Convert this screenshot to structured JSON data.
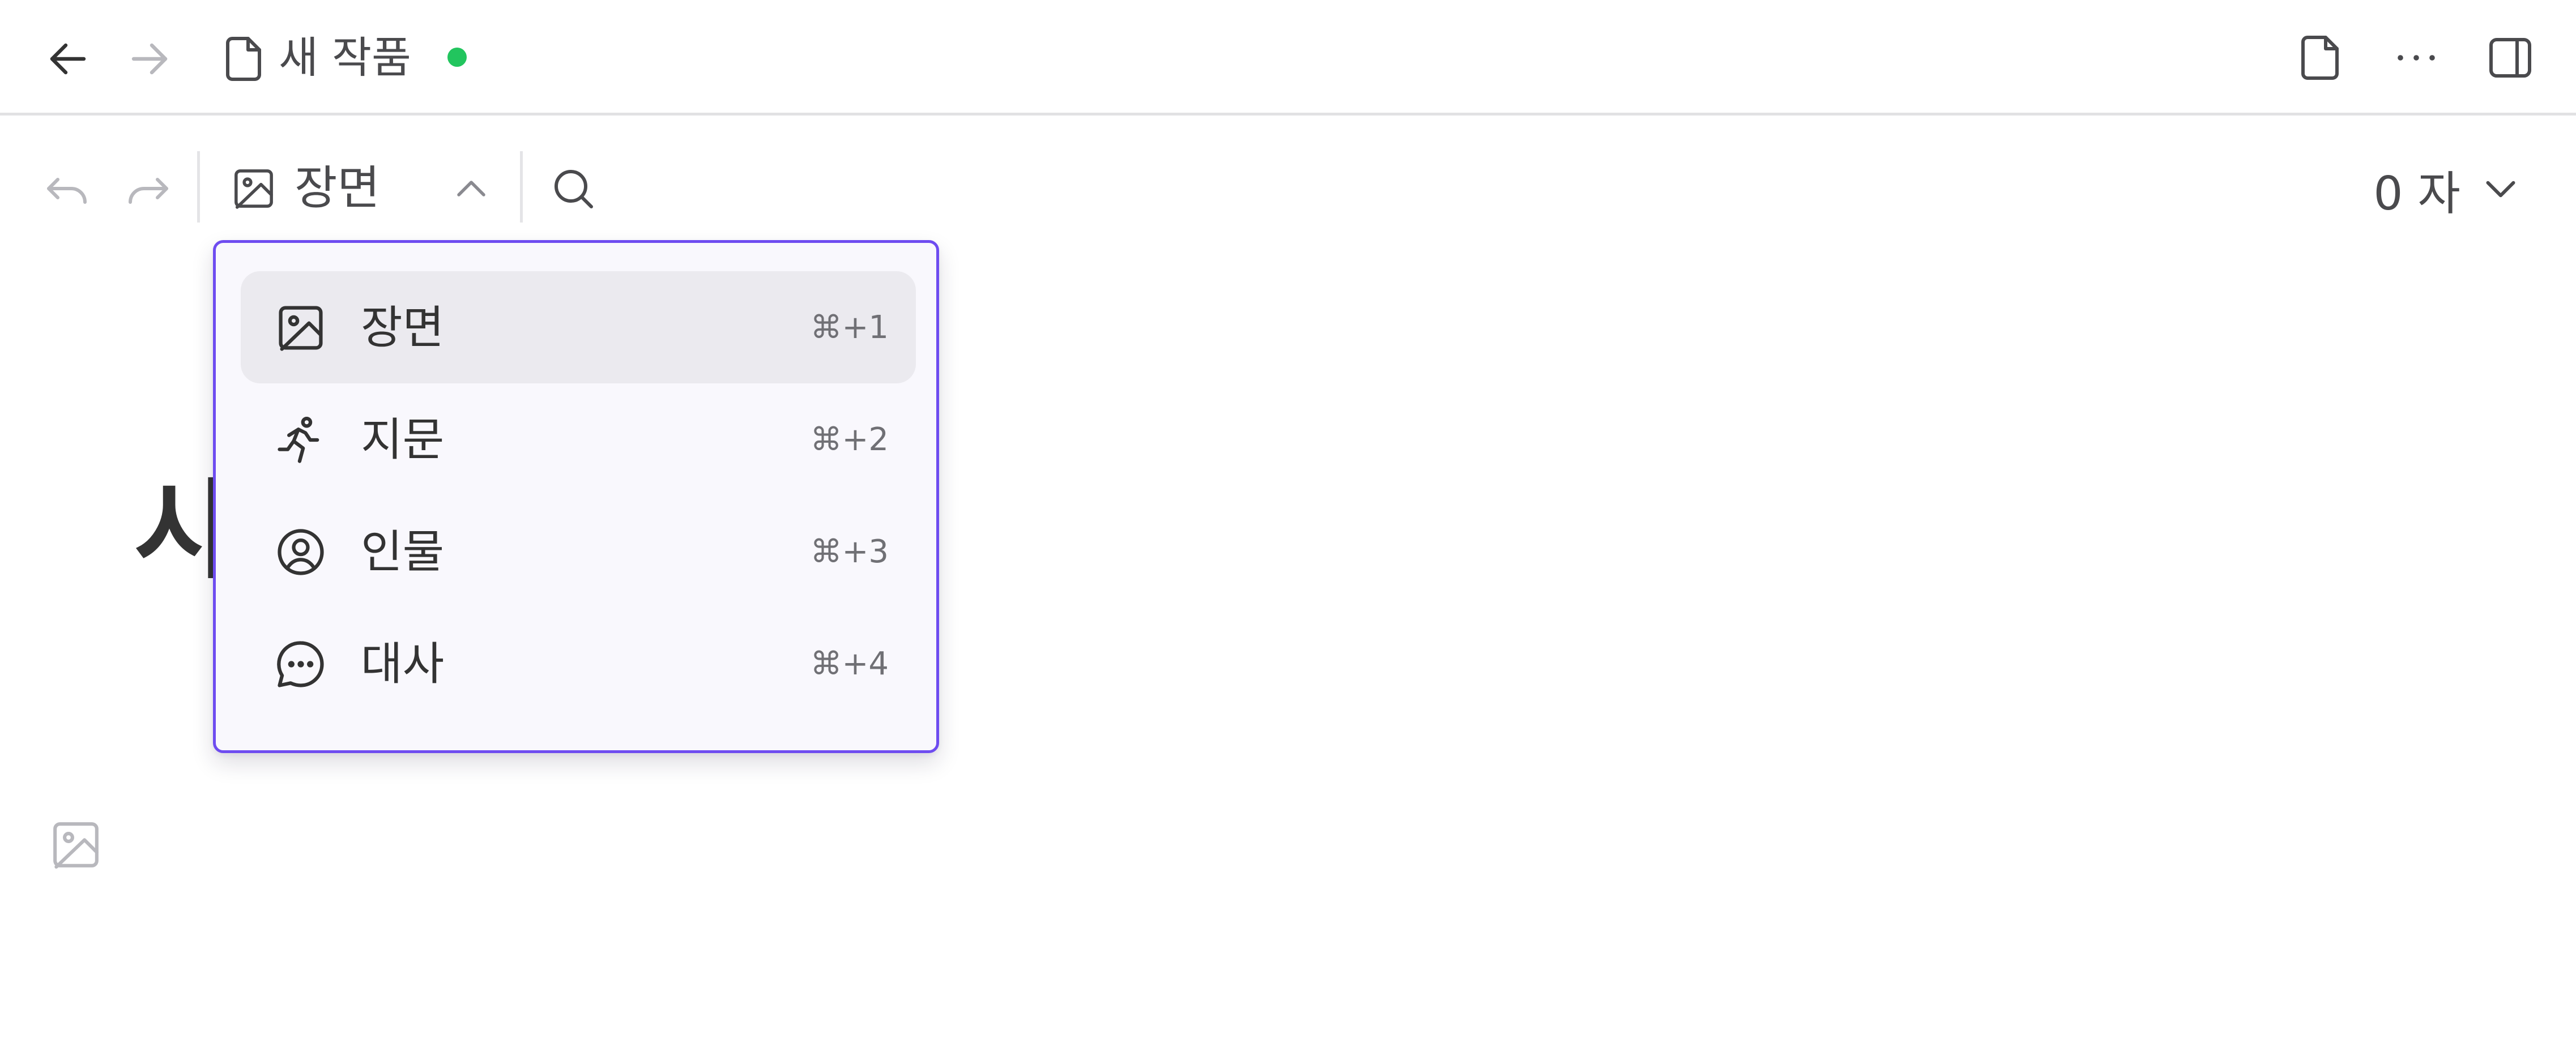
{
  "colors": {
    "accent": "#6e4cf0",
    "status_saved": "#22c55e",
    "text_primary": "#333333",
    "text_secondary": "#4a4a4d",
    "icon_disabled": "#b8b8bd",
    "menu_background": "#f9f8fd",
    "menu_item_active": "#ebeaef"
  },
  "titlebar": {
    "back_icon": "arrow-left-icon",
    "forward_icon": "arrow-right-icon",
    "doc_icon": "document-icon",
    "title": "새 작품",
    "status": "saved",
    "right_icons": [
      "page-icon",
      "more-horizontal-icon",
      "sidebar-toggle-icon"
    ]
  },
  "toolbar": {
    "undo_icon": "undo-icon",
    "redo_icon": "redo-icon",
    "block_type": {
      "icon": "image-icon",
      "label": "장면",
      "chevron": "chevron-up-icon"
    },
    "search_icon": "search-icon",
    "word_count": "0 자",
    "word_count_chevron": "chevron-down-icon"
  },
  "editor": {
    "title_partial": "시",
    "block_icon": "image-icon"
  },
  "block_menu": {
    "selected_index": 0,
    "items": [
      {
        "icon": "image-icon",
        "label": "장면",
        "shortcut": "⌘+1"
      },
      {
        "icon": "running-person-icon",
        "label": "지문",
        "shortcut": "⌘+2"
      },
      {
        "icon": "user-circle-icon",
        "label": "인물",
        "shortcut": "⌘+3"
      },
      {
        "icon": "chat-bubble-icon",
        "label": "대사",
        "shortcut": "⌘+4"
      }
    ]
  }
}
